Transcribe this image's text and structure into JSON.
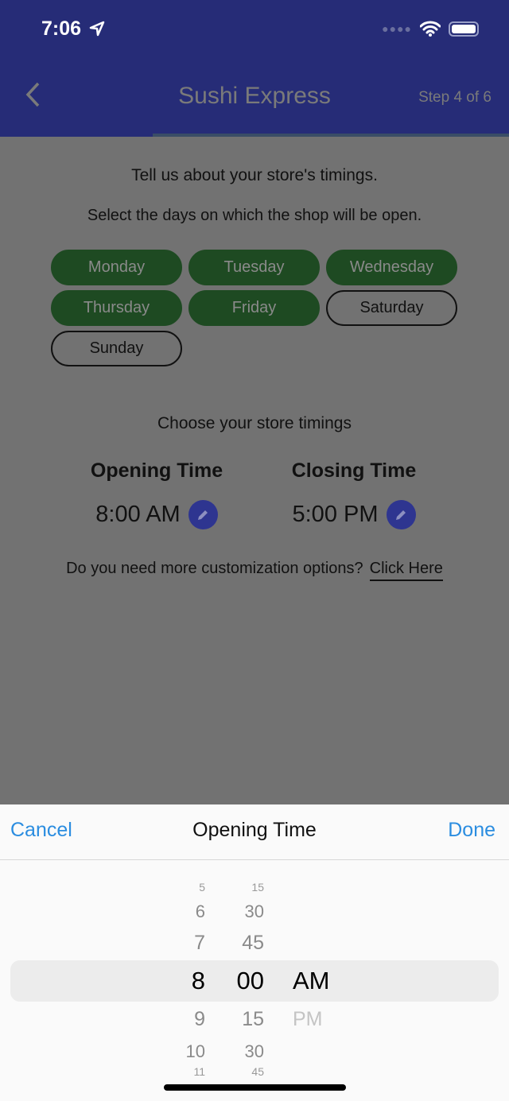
{
  "status_bar": {
    "time": "7:06"
  },
  "header": {
    "title": "Sushi Express",
    "step": "Step 4 of 6",
    "progress": 0.3
  },
  "main": {
    "intro": "Tell us about your store's timings.",
    "days_prompt": "Select the days on which the shop will be open.",
    "days": [
      {
        "label": "Monday",
        "selected": true
      },
      {
        "label": "Tuesday",
        "selected": true
      },
      {
        "label": "Wednesday",
        "selected": true
      },
      {
        "label": "Thursday",
        "selected": true
      },
      {
        "label": "Friday",
        "selected": true
      },
      {
        "label": "Saturday",
        "selected": false
      },
      {
        "label": "Sunday",
        "selected": false
      }
    ],
    "timings_prompt": "Choose your store timings",
    "opening": {
      "label": "Opening Time",
      "value": "8:00 AM"
    },
    "closing": {
      "label": "Closing Time",
      "value": "5:00 PM"
    },
    "more_text": "Do you need more customization options?",
    "more_link": "Click Here"
  },
  "picker": {
    "cancel": "Cancel",
    "title": "Opening Time",
    "done": "Done",
    "hours": [
      "5",
      "6",
      "7",
      "8",
      "9",
      "10",
      "11"
    ],
    "minutes": [
      "15",
      "30",
      "45",
      "00",
      "15",
      "30",
      "45"
    ],
    "period": [
      "AM",
      "PM"
    ],
    "selected": {
      "hour": "8",
      "minute": "00",
      "period": "AM"
    }
  },
  "colors": {
    "header": "#262c77",
    "selected_day": "#1e4a22",
    "link": "#2b8de0"
  }
}
